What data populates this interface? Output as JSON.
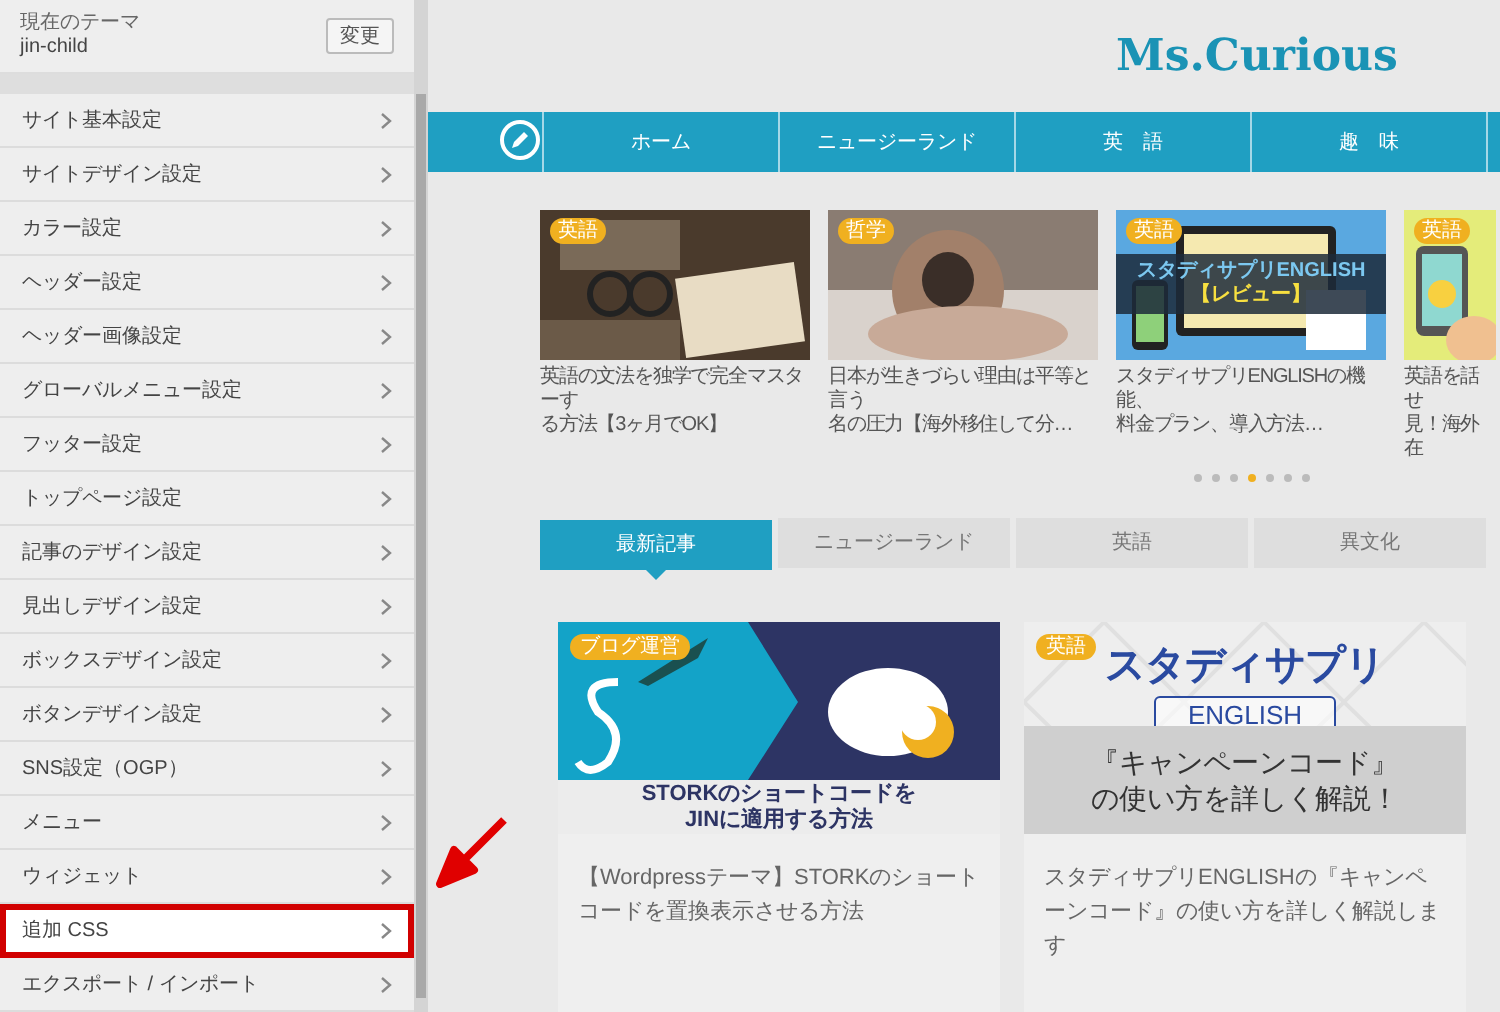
{
  "sidebar": {
    "theme_label": "現在のテーマ",
    "theme_name": "jin-child",
    "change_button": "変更",
    "items": [
      {
        "label": "サイト基本設定",
        "highlighted": false
      },
      {
        "label": "サイトデザイン設定",
        "highlighted": false
      },
      {
        "label": "カラー設定",
        "highlighted": false
      },
      {
        "label": "ヘッダー設定",
        "highlighted": false
      },
      {
        "label": "ヘッダー画像設定",
        "highlighted": false
      },
      {
        "label": "グローバルメニュー設定",
        "highlighted": false
      },
      {
        "label": "フッター設定",
        "highlighted": false
      },
      {
        "label": "トップページ設定",
        "highlighted": false
      },
      {
        "label": "記事のデザイン設定",
        "highlighted": false
      },
      {
        "label": "見出しデザイン設定",
        "highlighted": false
      },
      {
        "label": "ボックスデザイン設定",
        "highlighted": false
      },
      {
        "label": "ボタンデザイン設定",
        "highlighted": false
      },
      {
        "label": "SNS設定（OGP）",
        "highlighted": false
      },
      {
        "label": "メニュー",
        "highlighted": false
      },
      {
        "label": "ウィジェット",
        "highlighted": false
      },
      {
        "label": "追加 CSS",
        "highlighted": true
      },
      {
        "label": "エクスポート / インポート",
        "highlighted": false
      }
    ]
  },
  "site": {
    "logo": "Ms.Curious",
    "nav": [
      {
        "label": "ホーム"
      },
      {
        "label": "ニュージーランド"
      },
      {
        "label": "英　語"
      },
      {
        "label": "趣　味"
      }
    ]
  },
  "slider": {
    "cards": [
      {
        "badge": "英語",
        "lines": [
          "英語の文法を独学で完全マスターす",
          "る方法【3ヶ月でOK】"
        ]
      },
      {
        "badge": "哲学",
        "lines": [
          "日本が生きづらい理由は平等と言う",
          "名の圧力【海外移住して分…"
        ]
      },
      {
        "badge": "英語",
        "banner": [
          "スタディサプリENGLISH",
          "【レビュー】"
        ],
        "lines": [
          "スタディサプリENGLISHの機能、",
          "料金プラン、導入方法…"
        ]
      },
      {
        "badge": "英語",
        "lines": [
          "英語を話せ",
          "見！海外在"
        ]
      }
    ],
    "dots": [
      {
        "selected": false
      },
      {
        "selected": false
      },
      {
        "selected": false
      },
      {
        "selected": true
      },
      {
        "selected": false
      },
      {
        "selected": false
      },
      {
        "selected": false
      }
    ]
  },
  "tabs": [
    {
      "label": "最新記事",
      "selected": true
    },
    {
      "label": "ニュージーランド",
      "selected": false
    },
    {
      "label": "英語",
      "selected": false
    },
    {
      "label": "異文化",
      "selected": false
    }
  ],
  "posts": [
    {
      "badge": "ブログ運営",
      "banner": [
        "STORKのショートコードを",
        "JINに適用する方法"
      ],
      "title": "【Wordpressテーマ】STORKのショートコードを置換表示させる方法"
    },
    {
      "badge": "英語",
      "logo": [
        "スタディサプリ",
        "ENGLISH"
      ],
      "banner": [
        "『キャンペーンコード』",
        "の使い方を詳しく解説！"
      ],
      "title": "スタディサプリENGLISHの『キャンペーンコード』の使い方を詳しく解説します"
    }
  ]
}
